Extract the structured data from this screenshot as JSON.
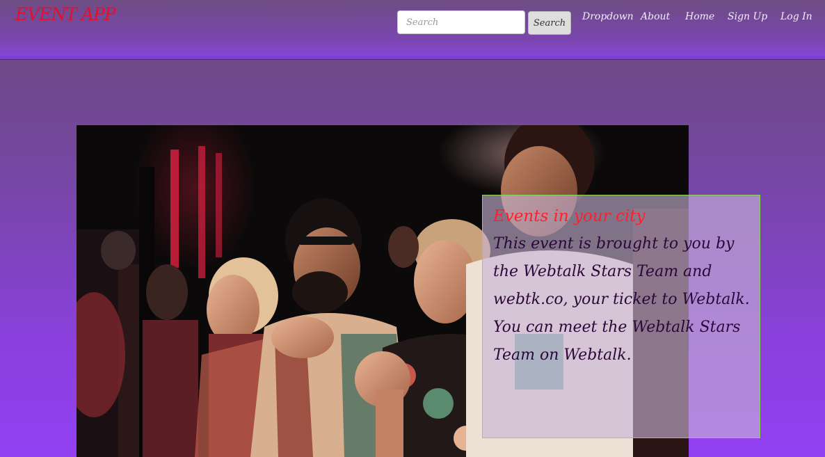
{
  "header": {
    "brand": "EVENT APP",
    "search": {
      "placeholder": "Search",
      "value": "",
      "button_label": "Search"
    },
    "nav": [
      "Dropdown",
      "About",
      "Home",
      "Sign Up",
      "Log In"
    ]
  },
  "hero": {
    "image_icon": "concert-crowd-photo",
    "caption_title": "Events in your city",
    "caption_body": "This event is brought to you by the Webtalk Stars Team and webtk.co, your ticket to Webtalk. You can meet the Webtalk Stars Team on Webtalk."
  },
  "colors": {
    "brand": "#e0102f",
    "caption_title": "#ff1f2a",
    "caption_body": "#2a083a",
    "card_border": "#8fd35f",
    "page_bottom": "#9340f2"
  }
}
